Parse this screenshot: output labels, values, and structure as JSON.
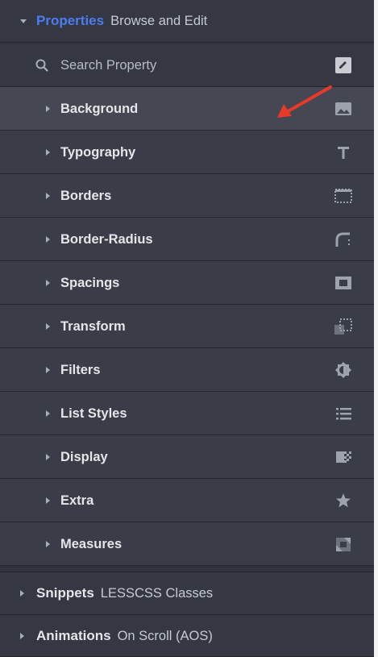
{
  "header": {
    "title": "Properties",
    "subtitle": "Browse and Edit"
  },
  "search": {
    "placeholder": "Search Property"
  },
  "properties": [
    {
      "label": "Background",
      "icon": "image-icon"
    },
    {
      "label": "Typography",
      "icon": "text-t-icon"
    },
    {
      "label": "Borders",
      "icon": "border-dotted-icon"
    },
    {
      "label": "Border-Radius",
      "icon": "border-radius-icon"
    },
    {
      "label": "Spacings",
      "icon": "spacing-box-icon"
    },
    {
      "label": "Transform",
      "icon": "transform-icon"
    },
    {
      "label": "Filters",
      "icon": "filter-contrast-icon"
    },
    {
      "label": "List Styles",
      "icon": "list-icon"
    },
    {
      "label": "Display",
      "icon": "display-checker-icon"
    },
    {
      "label": "Extra",
      "icon": "star-icon"
    },
    {
      "label": "Measures",
      "icon": "resize-icon"
    }
  ],
  "sections": [
    {
      "title": "Snippets",
      "subtitle": "LESSCSS Classes"
    },
    {
      "title": "Animations",
      "subtitle": "On Scroll (AOS)"
    }
  ],
  "colors": {
    "accent": "#4c7df0",
    "panel": "#30333c",
    "row": "#3a3d47",
    "annotation_arrow": "#e8392b"
  }
}
